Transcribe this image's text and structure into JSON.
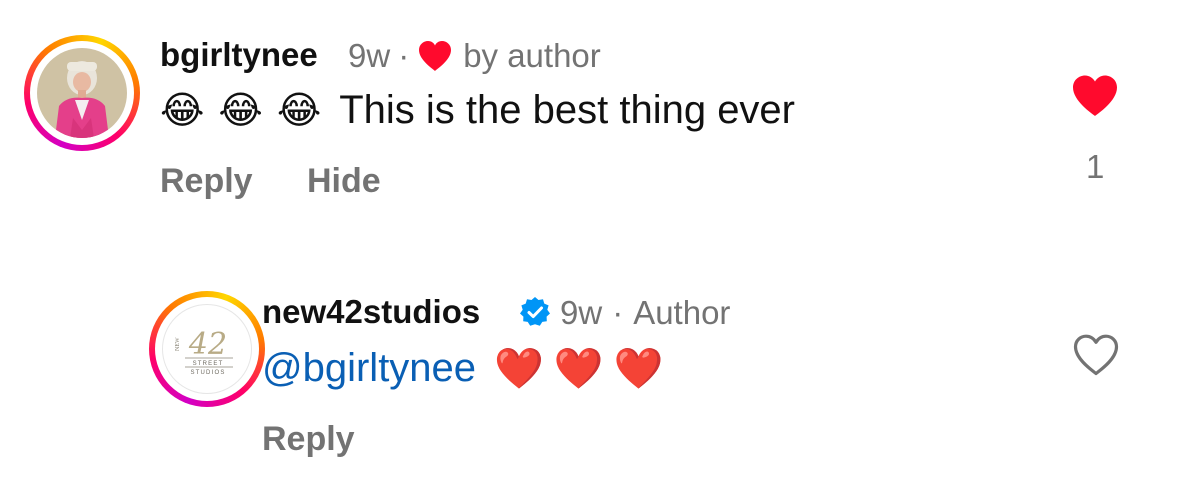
{
  "colors": {
    "liked_heart": "#ff0a2d",
    "secondary_text": "#737373",
    "mention": "#0a5fb4",
    "verified_badge": "#0095f6"
  },
  "comments": [
    {
      "username": "bgirltynee",
      "time": "9w",
      "separator": "·",
      "author_like_label": "by author",
      "text": "This is the best thing ever",
      "emojis": [
        "😂",
        "😂",
        "😂"
      ],
      "actions": {
        "reply": "Reply",
        "hide": "Hide"
      },
      "like_count": "1",
      "liked": true
    },
    {
      "username": "new42studios",
      "verified": true,
      "time": "9w",
      "separator": "·",
      "author_label": "Author",
      "mention": "@bgirltynee",
      "emojis": [
        "❤️",
        "❤️",
        "❤️"
      ],
      "actions": {
        "reply": "Reply"
      },
      "liked": false,
      "avatar_logo": {
        "number": "42",
        "line1": "STREET",
        "line2": "STUDIOS",
        "side": "NEW"
      }
    }
  ]
}
